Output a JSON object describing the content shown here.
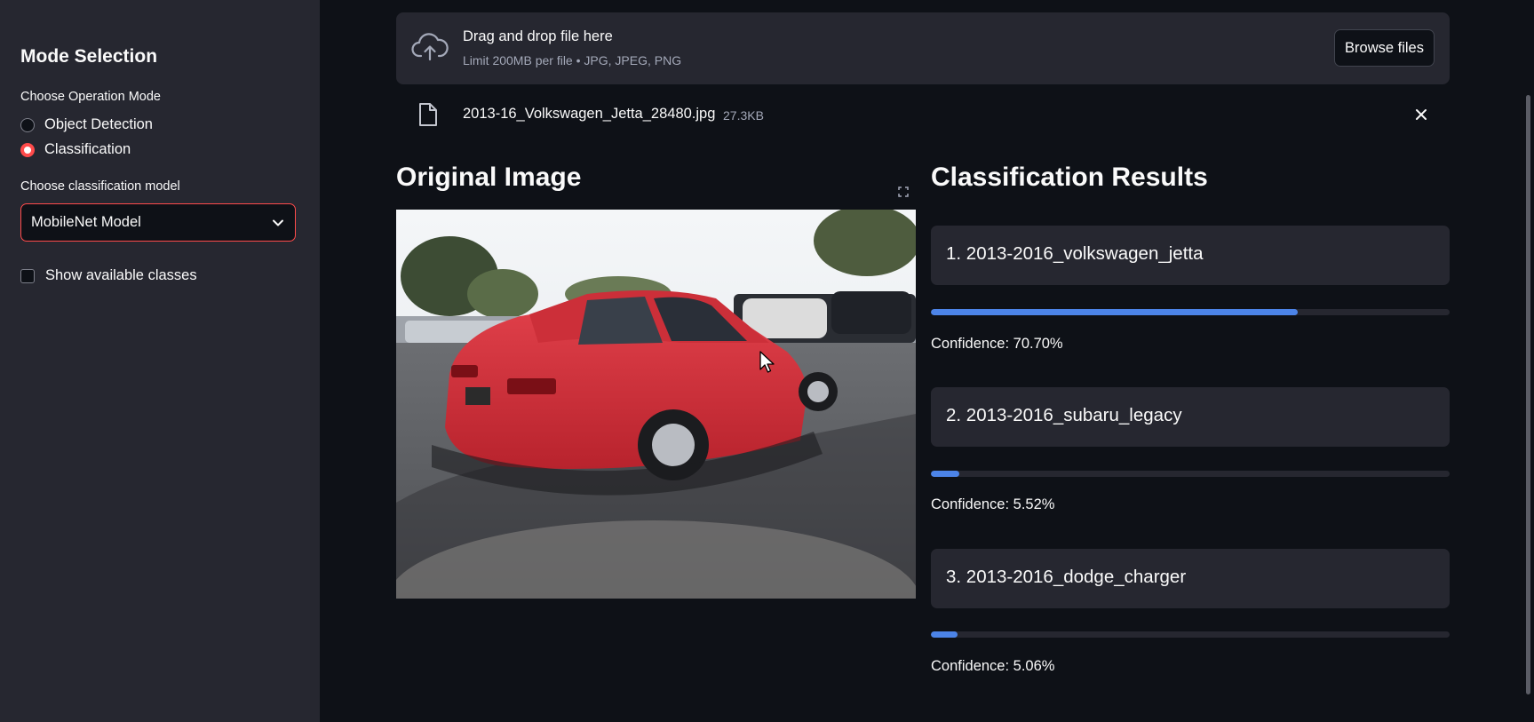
{
  "sidebar": {
    "title": "Mode Selection",
    "operation_label": "Choose Operation Mode",
    "modes": [
      {
        "label": "Object Detection",
        "selected": false
      },
      {
        "label": "Classification",
        "selected": true
      }
    ],
    "model_label": "Choose classification model",
    "model_selected": "MobileNet Model",
    "show_classes_label": "Show available classes",
    "show_classes_checked": false
  },
  "uploader": {
    "title": "Drag and drop file here",
    "subtitle": "Limit 200MB per file • JPG, JPEG, PNG",
    "browse_label": "Browse files",
    "file_name": "2013-16_Volkswagen_Jetta_28480.jpg",
    "file_size": "27.3KB"
  },
  "original": {
    "heading": "Original Image"
  },
  "results": {
    "heading": "Classification Results",
    "items": [
      {
        "label": "1. 2013-2016_volkswagen_jetta",
        "confidence_text": "Confidence: 70.70%",
        "confidence": 0.707
      },
      {
        "label": "2. 2013-2016_subaru_legacy",
        "confidence_text": "Confidence: 5.52%",
        "confidence": 0.0552
      },
      {
        "label": "3. 2013-2016_dodge_charger",
        "confidence_text": "Confidence: 5.06%",
        "confidence": 0.0506
      }
    ]
  },
  "colors": {
    "accent": "#ff4b4b",
    "progress": "#4c84e8",
    "background": "#0e1117",
    "panel": "#262730"
  }
}
